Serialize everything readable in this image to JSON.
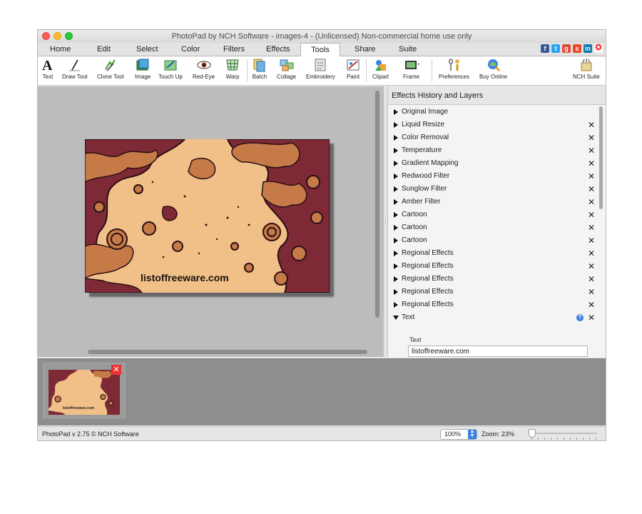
{
  "window": {
    "title": "PhotoPad by NCH Software - images-4 - (Unlicensed) Non-commercial home use only"
  },
  "menu": {
    "tabs": [
      "Home",
      "Edit",
      "Select",
      "Color",
      "Filters",
      "Effects",
      "Tools",
      "Share",
      "Suite"
    ],
    "active": "Tools"
  },
  "social_icons": [
    "facebook-icon",
    "twitter-icon",
    "google-plus-icon",
    "stumbleupon-icon",
    "linkedin-icon",
    "help-lifebuoy-icon"
  ],
  "toolbar": {
    "tools": [
      {
        "label": "Text",
        "icon": "text-A-icon"
      },
      {
        "label": "Draw Tool",
        "icon": "pencil-icon"
      },
      {
        "label": "Clone Tool",
        "icon": "clone-brush-icon"
      },
      {
        "label": "Image",
        "icon": "image-icon"
      },
      {
        "label": "Touch Up",
        "icon": "touch-up-icon"
      },
      {
        "label": "Red-Eye",
        "icon": "eye-icon"
      },
      {
        "label": "Warp",
        "icon": "warp-grid-icon"
      },
      {
        "label": "Batch",
        "icon": "batch-icon"
      },
      {
        "label": "Collage",
        "icon": "collage-icon"
      },
      {
        "label": "Embroidery",
        "icon": "embroidery-icon"
      },
      {
        "label": "Paint",
        "icon": "paint-icon"
      },
      {
        "label": "Clipart",
        "icon": "clipart-icon"
      },
      {
        "label": "Frame",
        "icon": "frame-icon"
      },
      {
        "label": "Preferences",
        "icon": "preferences-icon"
      },
      {
        "label": "Buy Online",
        "icon": "buy-online-icon"
      },
      {
        "label": "NCH Suite",
        "icon": "nch-suite-icon"
      }
    ]
  },
  "image": {
    "overlay_text": "listoffreeware.com",
    "colors": {
      "light": "#f0c088",
      "mid": "#c57a48",
      "dark": "#7e2a36",
      "outline": "#2a0f14"
    }
  },
  "panel": {
    "title": "Effects History and Layers",
    "layers": [
      {
        "label": "Original Image",
        "removable": false,
        "expanded": false
      },
      {
        "label": "Liquid Resize",
        "removable": true,
        "expanded": false
      },
      {
        "label": "Color Removal",
        "removable": true,
        "expanded": false
      },
      {
        "label": "Temperature",
        "removable": true,
        "expanded": false
      },
      {
        "label": "Gradient Mapping",
        "removable": true,
        "expanded": false
      },
      {
        "label": "Redwood Filter",
        "removable": true,
        "expanded": false
      },
      {
        "label": "Sunglow Filter",
        "removable": true,
        "expanded": false
      },
      {
        "label": "Amber Filter",
        "removable": true,
        "expanded": false
      },
      {
        "label": "Cartoon",
        "removable": true,
        "expanded": false
      },
      {
        "label": "Cartoon",
        "removable": true,
        "expanded": false
      },
      {
        "label": "Cartoon",
        "removable": true,
        "expanded": false
      },
      {
        "label": "Regional Effects",
        "removable": true,
        "expanded": false
      },
      {
        "label": "Regional Effects",
        "removable": true,
        "expanded": false
      },
      {
        "label": "Regional Effects",
        "removable": true,
        "expanded": false
      },
      {
        "label": "Regional Effects",
        "removable": true,
        "expanded": false
      },
      {
        "label": "Regional Effects",
        "removable": true,
        "expanded": false
      },
      {
        "label": "Text",
        "removable": true,
        "expanded": true,
        "help": true
      }
    ],
    "text_field_label": "Text",
    "text_field_value": "listoffreeware.com"
  },
  "status": {
    "copyright": "PhotoPad v 2.75 © NCH Software",
    "zoom_select": "100%",
    "zoom_label": "Zoom: 23%",
    "zoom_level": 0.0
  }
}
